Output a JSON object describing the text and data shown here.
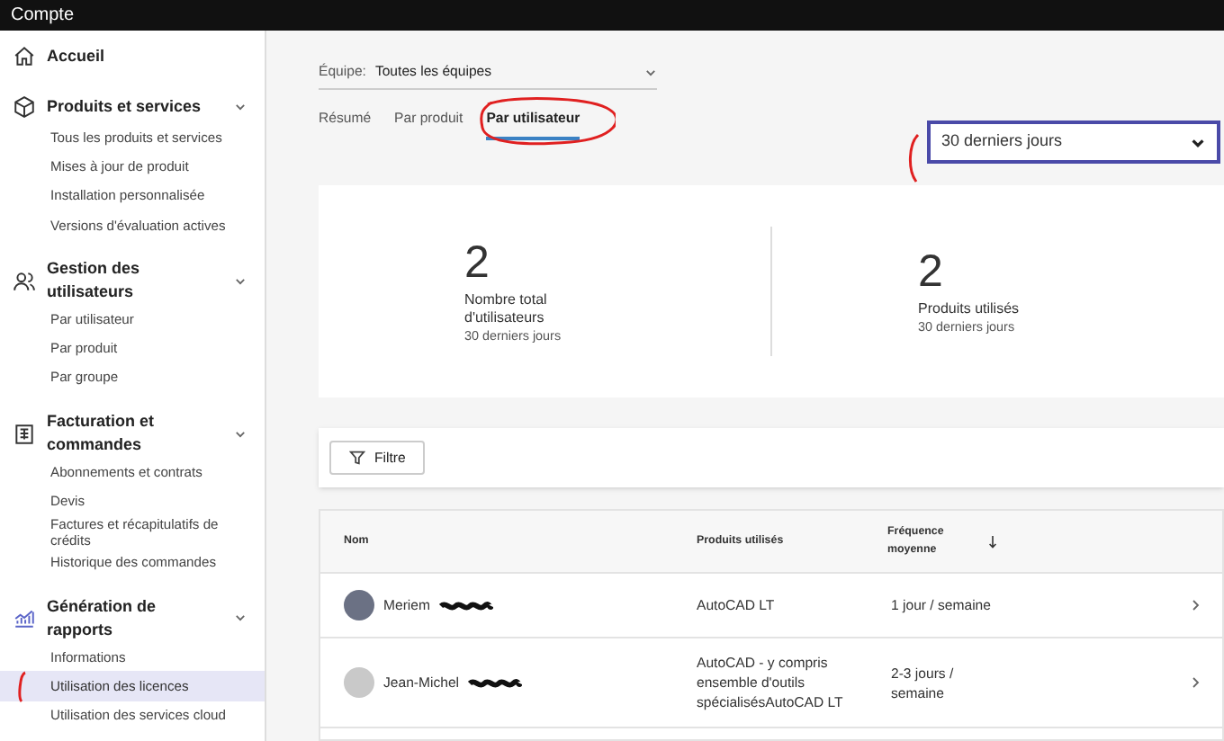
{
  "window": {
    "title": "Compte"
  },
  "sidebar": {
    "sections": [
      {
        "kind": "home",
        "title": "Accueil",
        "expandable": false
      },
      {
        "kind": "box",
        "title": "Produits et services",
        "expandable": true,
        "items": [
          {
            "label": "Tous les produits et services",
            "selected": false
          },
          {
            "label": "Mises à jour de produit",
            "selected": false
          },
          {
            "label": "Installation personnalisée",
            "selected": false
          },
          {
            "label": "Versions d'évaluation actives",
            "selected": false
          }
        ]
      },
      {
        "kind": "users",
        "title": "Gestion des utilisateurs",
        "expandable": true,
        "items": [
          {
            "label": "Par utilisateur",
            "selected": false
          },
          {
            "label": "Par produit",
            "selected": false
          },
          {
            "label": "Par groupe",
            "selected": false
          }
        ]
      },
      {
        "kind": "billing",
        "title": "Facturation et commandes",
        "expandable": true,
        "items": [
          {
            "label": "Abonnements et contrats",
            "selected": false
          },
          {
            "label": "Devis",
            "selected": false
          },
          {
            "label": "Factures et récapitulatifs de crédits",
            "selected": false
          },
          {
            "label": "Historique des commandes",
            "selected": false
          }
        ]
      },
      {
        "kind": "reports",
        "title": "Génération de rapports",
        "expandable": true,
        "items": [
          {
            "label": "Informations",
            "selected": false
          },
          {
            "label": "Utilisation des licences",
            "selected": true
          },
          {
            "label": "Utilisation des services cloud",
            "selected": false
          }
        ]
      }
    ]
  },
  "team_filter": {
    "label": "Équipe:",
    "value": "Toutes les équipes"
  },
  "tabs": [
    {
      "label": "Résumé",
      "selected": false
    },
    {
      "label": "Par produit",
      "selected": false
    },
    {
      "label": "Par utilisateur",
      "selected": true
    }
  ],
  "period": {
    "value": "30 derniers jours"
  },
  "stats": [
    {
      "value": "2",
      "label": "Nombre total d'utilisateurs",
      "period": "30 derniers jours"
    },
    {
      "value": "2",
      "label": "Produits utilisés",
      "period": "30 derniers jours"
    }
  ],
  "filter_button": "Filtre",
  "table": {
    "columns": [
      {
        "label": "Nom",
        "sorted": false
      },
      {
        "label": "Produits utilisés",
        "sorted": false
      },
      {
        "label": "Fréquence moyenne",
        "sorted": true
      }
    ],
    "rows": [
      {
        "name": "Meriem",
        "products": "AutoCAD LT",
        "frequency": "1 jour / semaine"
      },
      {
        "name": "Jean-Michel",
        "products": "AutoCAD - y compris ensemble d'outils spécialisésAutoCAD LT",
        "frequency": "2-3 jours / semaine"
      }
    ]
  }
}
